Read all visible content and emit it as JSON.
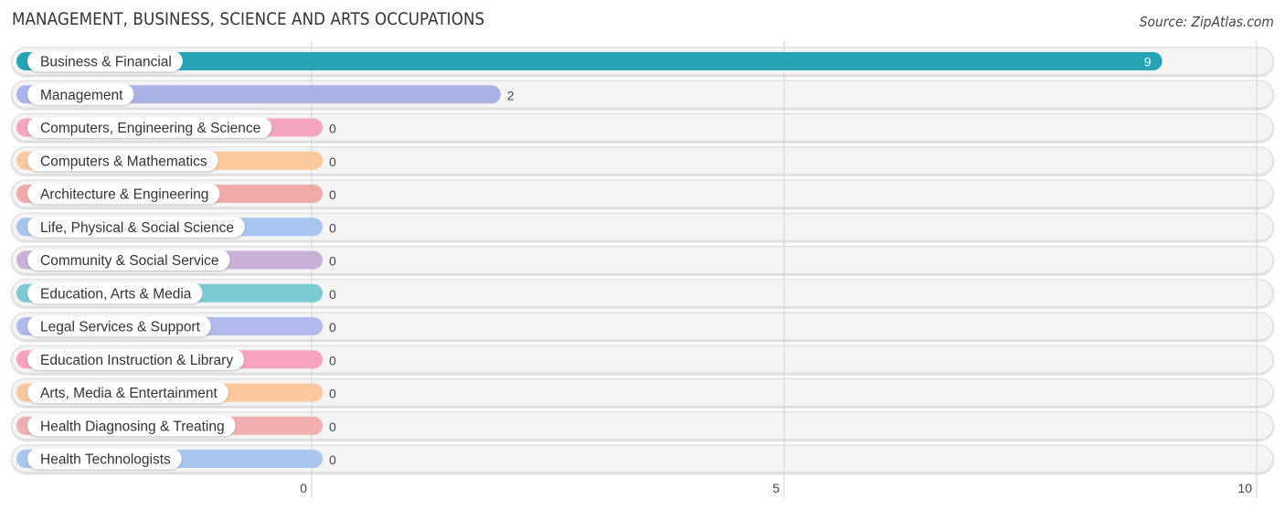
{
  "header": {
    "title": "MANAGEMENT, BUSINESS, SCIENCE AND ARTS OCCUPATIONS",
    "source": "Source: ZipAtlas.com"
  },
  "chart_data": {
    "type": "bar",
    "orientation": "horizontal",
    "title": "MANAGEMENT, BUSINESS, SCIENCE AND ARTS OCCUPATIONS",
    "xlabel": "",
    "ylabel": "",
    "xlim": [
      0,
      10
    ],
    "xticks": [
      0,
      5,
      10
    ],
    "grid": true,
    "categories": [
      "Business & Financial",
      "Management",
      "Computers, Engineering & Science",
      "Computers & Mathematics",
      "Architecture & Engineering",
      "Life, Physical & Social Science",
      "Community & Social Service",
      "Education, Arts & Media",
      "Legal Services & Support",
      "Education Instruction & Library",
      "Arts, Media & Entertainment",
      "Health Diagnosing & Treating",
      "Health Technologists"
    ],
    "values": [
      9,
      2,
      0,
      0,
      0,
      0,
      0,
      0,
      0,
      0,
      0,
      0,
      0
    ],
    "colors": [
      "#26a4b5",
      "#aab3e8",
      "#f5a5c0",
      "#fbc99b",
      "#f0aaa8",
      "#a7c5ee",
      "#c9b0d6",
      "#7ccbd4",
      "#b2b9ec",
      "#f7a3bf",
      "#fbc79c",
      "#f0aeae",
      "#a9c6ee"
    ]
  }
}
